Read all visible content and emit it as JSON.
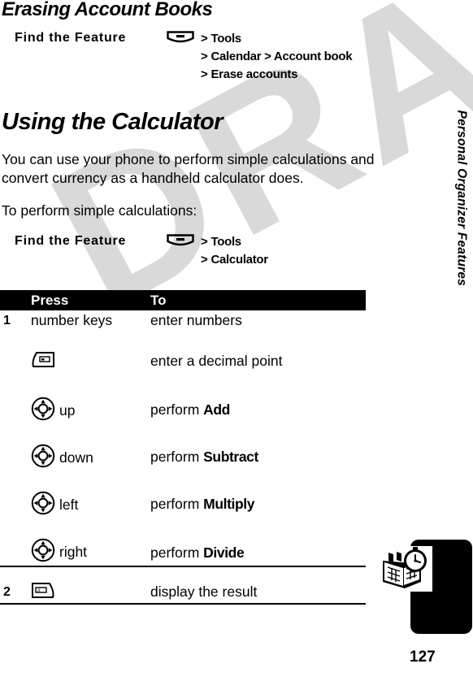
{
  "document": {
    "watermark": "DRAFT",
    "page_number": "127",
    "sidebar_chapter": "Personal Organizer Features"
  },
  "section_erasing": {
    "heading": "Erasing Account Books",
    "find_the_feature": {
      "label": "Find the Feature",
      "menu_icon": "menu-key-icon",
      "steps": [
        "Tools",
        "Calendar > Account book",
        "Erase accounts"
      ],
      "step_lines": [
        {
          "gt": ">",
          "text": "Tools"
        },
        {
          "gt": ">",
          "text": "Calendar > Account book"
        },
        {
          "gt": ">",
          "text": "Erase accounts"
        }
      ]
    }
  },
  "section_calculator": {
    "heading": "Using the Calculator",
    "paragraph": "You can use your phone to perform simple calculations and convert currency as a handheld calculator does.",
    "lead_in": "To perform simple calculations:",
    "find_the_feature": {
      "label": "Find the Feature",
      "menu_icon": "menu-key-icon",
      "step_lines": [
        {
          "gt": ">",
          "text": "Tools"
        },
        {
          "gt": ">",
          "text": "Calculator"
        }
      ]
    },
    "table": {
      "headers": {
        "num": "",
        "press": "Press",
        "to": "To"
      },
      "rows": [
        {
          "num": "1",
          "press_icon": "",
          "press_label": "number keys",
          "to_prefix": "enter numbers",
          "to_bold": "",
          "rule_above": false
        },
        {
          "num": "",
          "press_icon": "left-soft-key-icon",
          "press_label": "",
          "to_prefix": "enter a decimal point",
          "to_bold": "",
          "rule_above": false
        },
        {
          "num": "",
          "press_icon": "nav-key-icon",
          "press_label": "up",
          "to_prefix": "perform ",
          "to_bold": "Add",
          "rule_above": false
        },
        {
          "num": "",
          "press_icon": "nav-key-icon",
          "press_label": "down",
          "to_prefix": "perform ",
          "to_bold": "Subtract",
          "rule_above": false
        },
        {
          "num": "",
          "press_icon": "nav-key-icon",
          "press_label": "left",
          "to_prefix": "perform ",
          "to_bold": "Multiply",
          "rule_above": false
        },
        {
          "num": "",
          "press_icon": "nav-key-icon",
          "press_label": "right",
          "to_prefix": "perform ",
          "to_bold": "Divide",
          "rule_above": false
        },
        {
          "num": "2",
          "press_icon": "right-soft-key-icon",
          "press_label": "",
          "to_prefix": "display the result",
          "to_bold": "",
          "rule_above": true
        }
      ]
    }
  },
  "colors": {
    "ink": "#000000",
    "paper": "#ffffff",
    "watermark": "#d9d9d9"
  }
}
